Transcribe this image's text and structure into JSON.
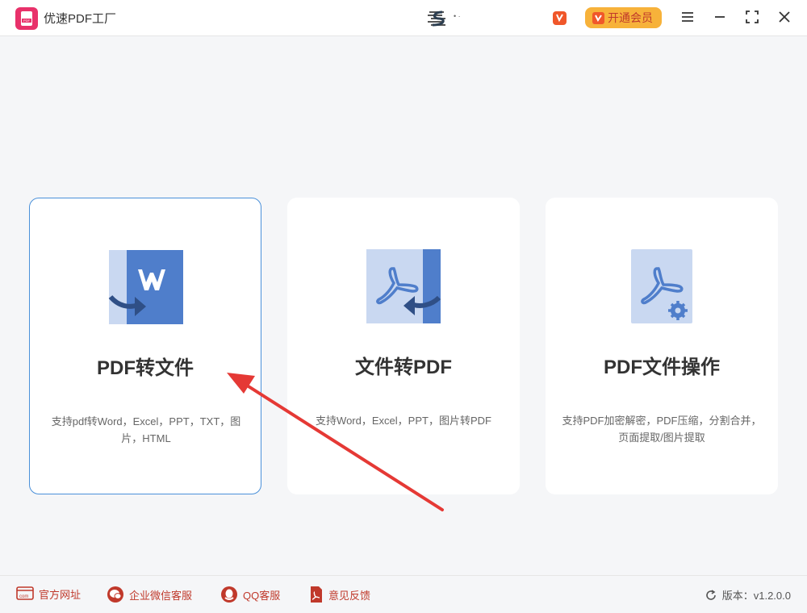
{
  "app": {
    "title": "优速PDF工厂",
    "logo_text": "PDF",
    "brand_text": "• ·"
  },
  "titlebar": {
    "vip_label": "开通会员",
    "icons": [
      "vip-badge-icon",
      "menu-icon",
      "minimize-icon",
      "maximize-icon",
      "close-icon"
    ]
  },
  "cards": [
    {
      "title": "PDF转文件",
      "desc": "支持pdf转Word，Excel，PPT，TXT，图片，HTML",
      "icon": "pdf-to-word-icon",
      "selected": true
    },
    {
      "title": "文件转PDF",
      "desc": "支持Word，Excel，PPT，图片转PDF",
      "icon": "file-to-pdf-icon",
      "selected": false
    },
    {
      "title": "PDF文件操作",
      "desc": "支持PDF加密解密，PDF压缩，分割合并，页面提取/图片提取",
      "icon": "pdf-settings-icon",
      "selected": false
    }
  ],
  "footer": {
    "links": [
      {
        "label": "官方网址",
        "icon": "website-icon"
      },
      {
        "label": "企业微信客服",
        "icon": "wechat-icon"
      },
      {
        "label": "QQ客服",
        "icon": "qq-icon"
      },
      {
        "label": "意见反馈",
        "icon": "feedback-icon"
      }
    ],
    "version": "版本：v1.2.0.0"
  },
  "colors": {
    "accent": "#4a90d9",
    "brand_red": "#e8316a",
    "vip_orange": "#f7b23a",
    "footer_red": "#c0392b",
    "arrow_red": "#e53935"
  }
}
